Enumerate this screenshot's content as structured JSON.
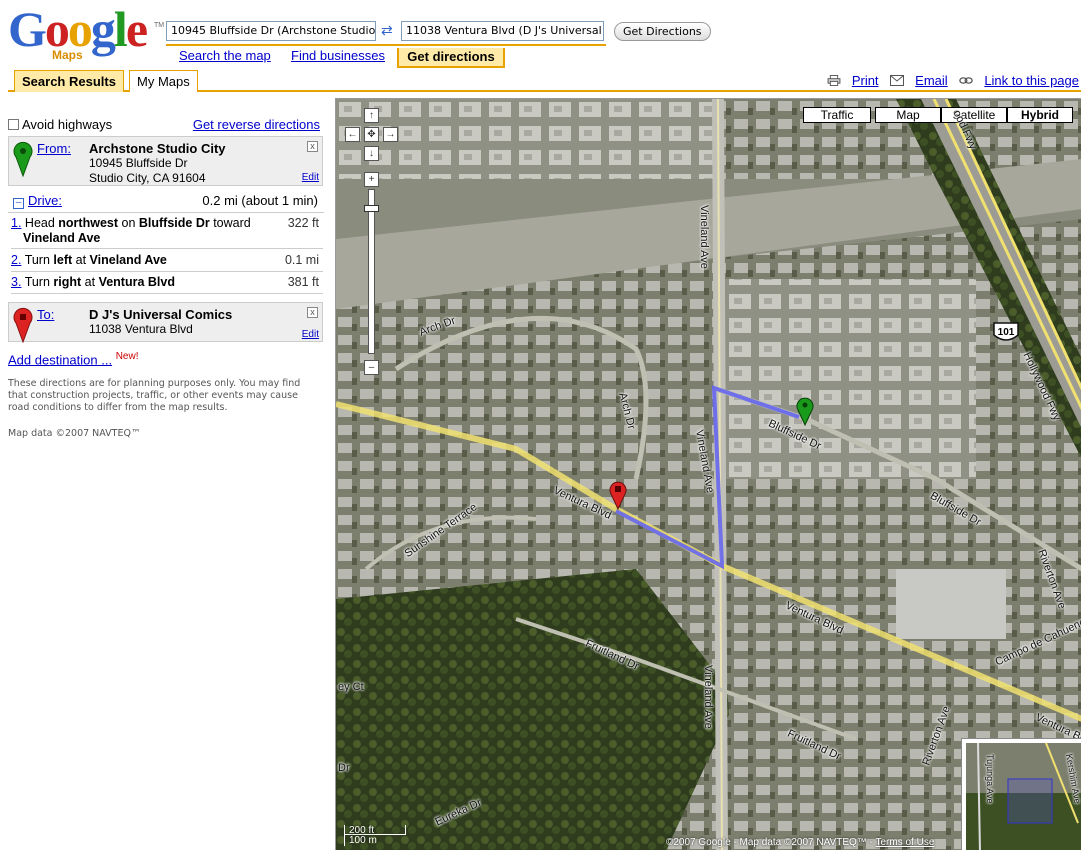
{
  "logo": {
    "word": "Google",
    "sub": "Maps",
    "tm": "TM"
  },
  "search": {
    "from_value": "10945 Bluffside Dr (Archstone Studio",
    "to_value": "11038 Ventura Blvd (D J's Universal C",
    "swap_icon": "swap-icon",
    "button": "Get Directions",
    "tabs": {
      "search_map": "Search the map",
      "find_businesses": "Find businesses",
      "get_directions": "Get directions"
    }
  },
  "panel_tabs": {
    "search_results": "Search Results",
    "my_maps": "My Maps"
  },
  "page_links": {
    "print": "Print",
    "email": "Email",
    "link": "Link to this page"
  },
  "directions": {
    "avoid_highways": "Avoid highways",
    "reverse": "Get reverse directions",
    "from": {
      "label": "From:",
      "name": "Archstone Studio City",
      "line1": "10945 Bluffside Dr",
      "line2": "Studio City, CA 91604",
      "edit": "Edit",
      "close": "x"
    },
    "drive": {
      "label": "Drive:",
      "summary": "0.2 mi (about 1 min)"
    },
    "steps": [
      {
        "num": "1.",
        "pre": "Head ",
        "b1": "northwest",
        "mid": " on ",
        "b2": "Bluffside Dr",
        "post": " toward ",
        "b3": "Vineland Ave",
        "dist": "322 ft"
      },
      {
        "num": "2.",
        "pre": "Turn ",
        "b1": "left",
        "mid": " at ",
        "b2": "Vineland Ave",
        "dist": "0.1 mi"
      },
      {
        "num": "3.",
        "pre": "Turn ",
        "b1": "right",
        "mid": " at ",
        "b2": "Ventura Blvd",
        "dist": "381 ft"
      }
    ],
    "to": {
      "label": "To:",
      "name": "D J's Universal Comics",
      "line1": "11038 Ventura Blvd",
      "edit": "Edit",
      "close": "x"
    },
    "add_destination": "Add destination ...",
    "new_badge": "New!",
    "disclaimer": "These directions are for planning purposes only. You may find that construction projects, traffic, or other events may cause road conditions to differ from the map results.",
    "map_data": "Map data ©2007 NAVTEQ™"
  },
  "map": {
    "buttons": {
      "traffic": "Traffic",
      "map": "Map",
      "satellite": "Satellite",
      "hybrid": "Hybrid"
    },
    "active_type": "Hybrid",
    "streets": {
      "vineland_top": "Vineland Ave",
      "vineland_mid": "Vineland Ave",
      "vineland_bottom": "Vineland Ave",
      "arch_dr": "Arch Dr",
      "arch_dr_v": "Arch Dr",
      "bluffside_1": "Bluffside Dr",
      "bluffside_2": "Bluffside Dr",
      "ventura_1": "Ventura Blvd",
      "ventura_2": "Ventura Blvd",
      "ventura_3": "Ventura Blvd",
      "sunshine": "Sunshine Terrace",
      "fruitland_1": "Fruitland Dr",
      "fruitland_2": "Fruitland Dr",
      "riverton_1": "Riverton Ave",
      "riverton_2": "Riverton Ave",
      "campo": "Campo de Cahuenga",
      "hollywood": "Hollywood Fwy",
      "hollywood_top": "ood Fwy",
      "eureka": "Eureka Dr",
      "ey_ct": "ey Ct",
      "dr_fragment": "Dr",
      "tujunga": "Tujunga Ave",
      "kershim": "Kershim Ave"
    },
    "shield": "101",
    "scale": {
      "ft": "200 ft",
      "m": "100 m"
    },
    "copyright": "©2007 Google - Map data ©2007 NAVTEQ™ - ",
    "terms": "Terms of Use",
    "colors": {
      "route": "#6666ee",
      "yellow_road": "#f0e070",
      "from_pin": "#1a9a1a",
      "to_pin": "#dd2222",
      "accent": "#e8a200"
    }
  }
}
